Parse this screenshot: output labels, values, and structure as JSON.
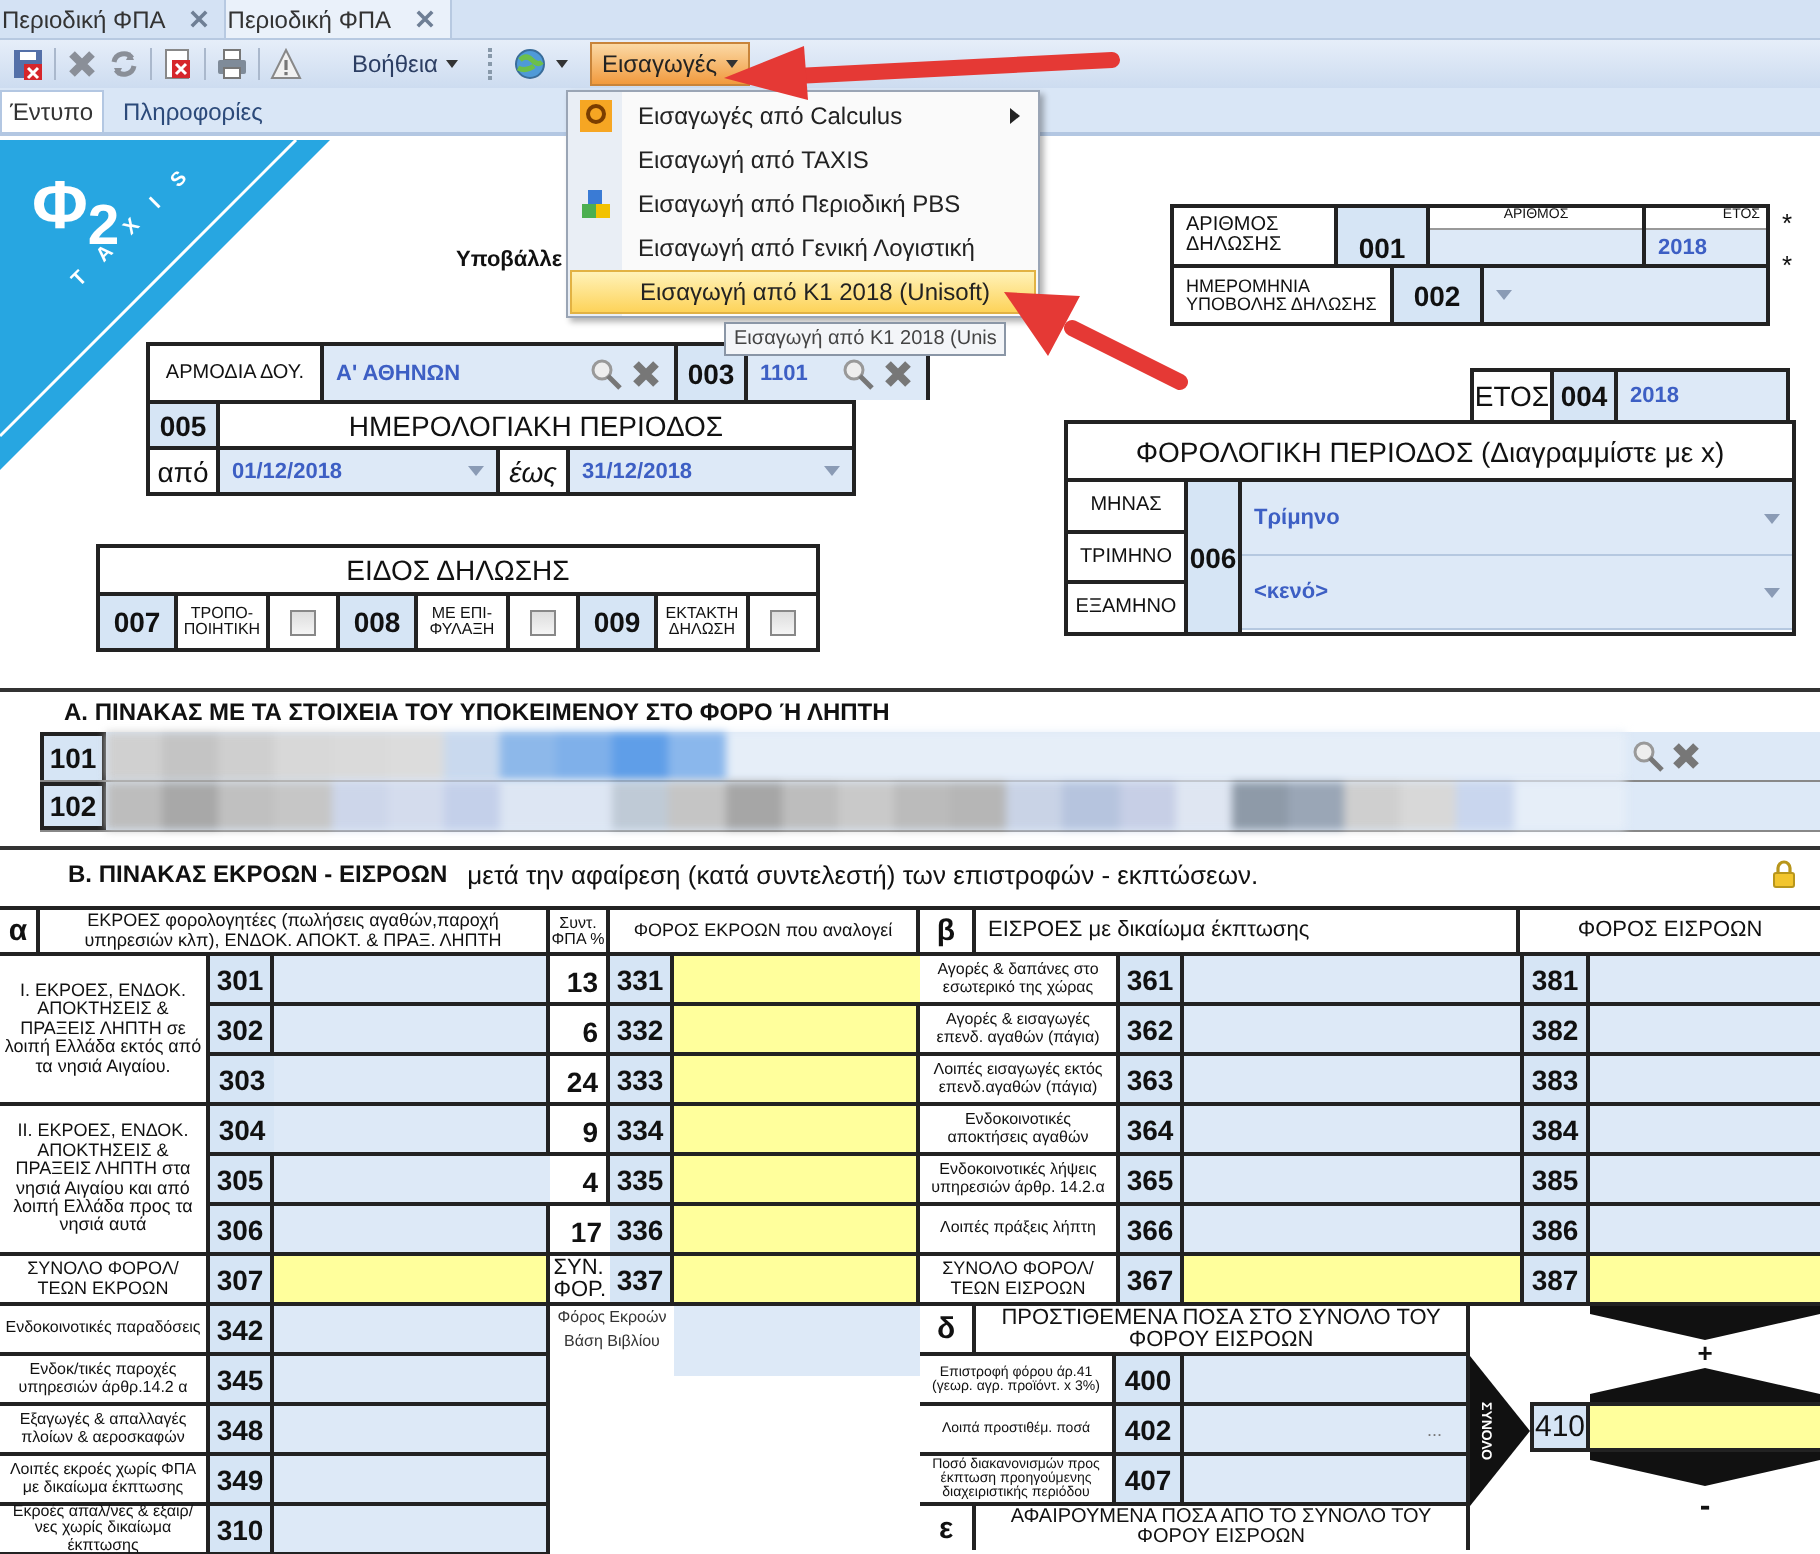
{
  "doc_tabs": [
    {
      "label": "Περιοδική ΦΠΑ",
      "selected": false
    },
    {
      "label": "Περιοδική ΦΠΑ",
      "selected": true
    }
  ],
  "toolbar": {
    "help": "Βοήθεια",
    "imports": {
      "label": "Εισαγωγές",
      "open": true
    }
  },
  "imports_menu": [
    {
      "label": "Εισαγωγές από Calculus",
      "kind": "logo",
      "submenu": true,
      "selected": false
    },
    {
      "label": "Εισαγωγή από TAXIS",
      "kind": "plain",
      "submenu": false,
      "selected": false
    },
    {
      "label": "Εισαγωγή από Περιοδική PBS",
      "kind": "cubes",
      "submenu": false,
      "selected": false
    },
    {
      "label": "Εισαγωγή από Γενική Λογιστική",
      "kind": "plain",
      "submenu": false,
      "selected": false
    },
    {
      "label": "Εισαγωγή από Κ1 2018 (Unisoft)",
      "kind": "plain",
      "submenu": false,
      "selected": true
    }
  ],
  "tooltip": "Εισαγωγή από Κ1 2018 (Unis",
  "view_tabs": [
    {
      "label": "Έντυπο",
      "selected": true
    },
    {
      "label": "Πληροφορίες",
      "selected": false
    }
  ],
  "logo": {
    "text": "Φ$_{2}$",
    "band": "TAXIS"
  },
  "submitter_label": "Υποβάλλε",
  "declaration_number": {
    "label": "ΑΡΙΘΜΟΣ ΔΗΛΩΣΗΣ",
    "code": "001",
    "number_label": "ΑΡΙΘΜΟΣ",
    "year_label": "ΕΤΟΣ",
    "year": "2018",
    "required": "*"
  },
  "submission_date": {
    "label": "ΗΜΕΡΟΜΗΝΙΑ ΥΠΟΒΟΛΗΣ ΔΗΛΩΣΗΣ",
    "code": "002",
    "required": "*"
  },
  "tax_office": {
    "label": "ΑΡΜΟΔΙΑ ΔΟΥ.",
    "value": "Α' ΑΘΗΝΩΝ",
    "code": "003",
    "code_value": "1101"
  },
  "calendar_period": {
    "code": "005",
    "title": "ΗΜΕΡΟΛΟΓΙΑΚΗ ΠΕΡΙΟΔΟΣ",
    "from_label": "από",
    "from": "01/12/2018",
    "to_label": "έως",
    "to": "31/12/2018"
  },
  "year": {
    "label": "ΕΤΟΣ",
    "code": "004",
    "value": "2018"
  },
  "tax_period": {
    "title": "ΦΟΡΟΛΟΓΙΚΗ ΠΕΡΙΟΔΟΣ (Διαγραμμίστε με x)",
    "code": "006",
    "labels": [
      "ΜΗΝΑΣ",
      "ΤΡΙΜΗΝΟ",
      "ΕΞΑΜΗΝΟ"
    ],
    "selects": [
      "Τρίμηνο",
      "<κενό>"
    ]
  },
  "declaration_type": {
    "title": "ΕΙΔΟΣ  ΔΗΛΩΣΗΣ",
    "options": [
      {
        "code": "007",
        "label": "ΤΡΟΠΟ-ΠΟΙΗΤΙΚΗ",
        "checked": false
      },
      {
        "code": "008",
        "label": "ΜΕ ΕΠΙ-ΦΥΛΑΞΗ",
        "checked": false
      },
      {
        "code": "009",
        "label": "ΕΚΤΑΚΤΗ ΔΗΛΩΣΗ",
        "checked": false
      }
    ]
  },
  "section_a": {
    "title": "Α. ΠΙΝΑΚΑΣ ΜΕ ΤΑ ΣΤΟΙΧΕΙΑ ΤΟΥ ΥΠΟΚΕΙΜΕΝΟΥ ΣΤΟ ΦΟΡΟ Ή ΛΗΠΤΗ",
    "rows": [
      {
        "code": "101",
        "lookup": true
      },
      {
        "code": "102",
        "lookup": false
      }
    ]
  },
  "section_b": {
    "title": "Β. ΠΙΝΑΚΑΣ ΕΚΡΟΩΝ - ΕΙΣΡΟΩΝ",
    "subtitle": "μετά την αφαίρεση (κατά συντελεστή) των επιστροφών - εκπτώσεων.",
    "locked": true
  },
  "outputs": {
    "letter": "α",
    "title": "ΕΚΡΟΕΣ φορολογητέες (πωλήσεις αγαθών,παροχή υπηρεσιών κλπ), ΕΝΔΟΚ. ΑΠΟΚΤ. & ΠΡΑΞ. ΛΗΠΤΗ",
    "rate_title": "Συντ. ΦΠΑ %",
    "tax_title": "ΦΟΡΟΣ ΕΚΡΟΩΝ που αναλογεί",
    "groups": [
      {
        "label": "Ι. ΕΚΡΟΕΣ, ΕΝΔΟΚ. ΑΠΟΚΤΗΣΕΙΣ & ΠΡΑΞΕΙΣ ΛΗΠΤΗ σε λοιπή Ελλάδα εκτός από τα νησιά Αιγαίου.",
        "rows": [
          {
            "code": "301",
            "computed": false,
            "rate": "13",
            "tax_code": "331",
            "tax_computed": true
          },
          {
            "code": "302",
            "computed": false,
            "rate": "6",
            "tax_code": "332",
            "tax_computed": true
          },
          {
            "code": "303",
            "computed": false,
            "rate": "24",
            "tax_code": "333",
            "tax_computed": true
          }
        ]
      },
      {
        "label": "ΙΙ. ΕΚΡΟΕΣ, ΕΝΔΟΚ. ΑΠΟΚΤΗΣΕΙΣ & ΠΡΑΞΕΙΣ ΛΗΠΤΗ στα νησιά Αιγαίου και από λοιπή Ελλάδα προς τα νησιά αυτά",
        "rows": [
          {
            "code": "304",
            "computed": false,
            "rate": "9",
            "tax_code": "334",
            "tax_computed": true
          },
          {
            "code": "305",
            "computed": false,
            "rate": "4",
            "tax_code": "335",
            "tax_computed": true
          },
          {
            "code": "306",
            "computed": false,
            "rate": "17",
            "tax_code": "336",
            "tax_computed": true
          }
        ]
      }
    ],
    "total": {
      "label": "ΣΥΝΟΛΟ ΦΟΡΟΛ/ΤΕΩΝ ΕΚΡΟΩΝ",
      "code": "307",
      "computed": true,
      "rate": "ΣΥΝ. ΦΟΡ.",
      "tax_code": "337",
      "tax_computed": true
    },
    "other_rows": [
      {
        "label": "Ενδοκοινοτικές παραδόσεις",
        "code": "342",
        "computed": false
      },
      {
        "label": "Ενδοκ/τικές παροχές υπηρεσιών άρθρ.14.2 α",
        "code": "345",
        "computed": false
      },
      {
        "label": "Εξαγωγές & απαλλαγές πλοίων & αεροσκαφών",
        "code": "348",
        "computed": false
      },
      {
        "label": "Λοιπές εκροές χωρίς ΦΠΑ με δικαίωμα έκπτωσης",
        "code": "349",
        "computed": false
      },
      {
        "label": "Εκροές απαλ/νες & εξαιρ/νες χωρίς δικαίωμα έκπτωσης",
        "code": "310",
        "computed": false
      }
    ],
    "book_tax_label": "Φόρος Εκροών Βάση Βιβλίου"
  },
  "inputs": {
    "letter": "β",
    "title": "ΕΙΣΡΟΕΣ με δικαίωμα έκπτωσης",
    "tax_title": "ΦΟΡΟΣ ΕΙΣΡΟΩΝ",
    "rows": [
      {
        "label": "Αγορές & δαπάνες στο εσωτερικό της χώρας",
        "code": "361",
        "computed": false,
        "tax_code": "381",
        "tax_computed": false
      },
      {
        "label": "Αγορές & εισαγωγές επενδ. αγαθών (πάγια)",
        "code": "362",
        "computed": false,
        "tax_code": "382",
        "tax_computed": false
      },
      {
        "label": "Λοιπές εισαγωγές εκτός επενδ.αγαθών (πάγια)",
        "code": "363",
        "computed": false,
        "tax_code": "383",
        "tax_computed": false
      },
      {
        "label": "Ενδοκοινοτικές αποκτήσεις αγαθών",
        "code": "364",
        "computed": false,
        "tax_code": "384",
        "tax_computed": false
      },
      {
        "label": "Ενδοκοινοτικές λήψεις υπηρεσιών άρθρ. 14.2.α",
        "code": "365",
        "computed": false,
        "tax_code": "385",
        "tax_computed": false
      },
      {
        "label": "Λοιπές πράξεις λήπτη",
        "code": "366",
        "computed": false,
        "tax_code": "386",
        "tax_computed": false
      },
      {
        "label": "ΣΥΝΟΛΟ ΦΟΡΟΛ/ΤΕΩΝ ΕΙΣΡΟΩΝ",
        "code": "367",
        "computed": true,
        "tax_code": "387",
        "tax_computed": true
      }
    ]
  },
  "additions": {
    "letter": "δ",
    "title": "ΠΡΟΣΤΙΘΕΜΕΝΑ ΠΟΣΑ ΣΤΟ ΣΥΝΟΛΟ ΤΟΥ ΦΟΡΟΥ ΕΙΣΡΟΩΝ",
    "rows": [
      {
        "label": "Επιστροφή φόρου άρ.41 (γεωρ. αγρ. προϊόντ. x 3%)",
        "code": "400",
        "value": ""
      },
      {
        "label": "Λοιπά προστιθέμ. ποσά",
        "code": "402",
        "value": "..."
      },
      {
        "label": "Ποσό διακανονισμών προς έκπτωση προηγούμενης διαχειριστικής περιόδου",
        "code": "407",
        "value": ""
      }
    ]
  },
  "total_410": {
    "arrow_label": "ΣΥΝΟΛΟ",
    "code": "410",
    "computed": true,
    "plus": "+",
    "minus": "-"
  },
  "deductions": {
    "letter": "ε",
    "title": "ΑΦΑΙΡΟΥΜΕΝΑ ΠΟΣΑ ΑΠΟ ΤΟ ΣΥΝΟΛΟ ΤΟΥ ΦΟΡΟΥ ΕΙΣΡΟΩΝ"
  }
}
